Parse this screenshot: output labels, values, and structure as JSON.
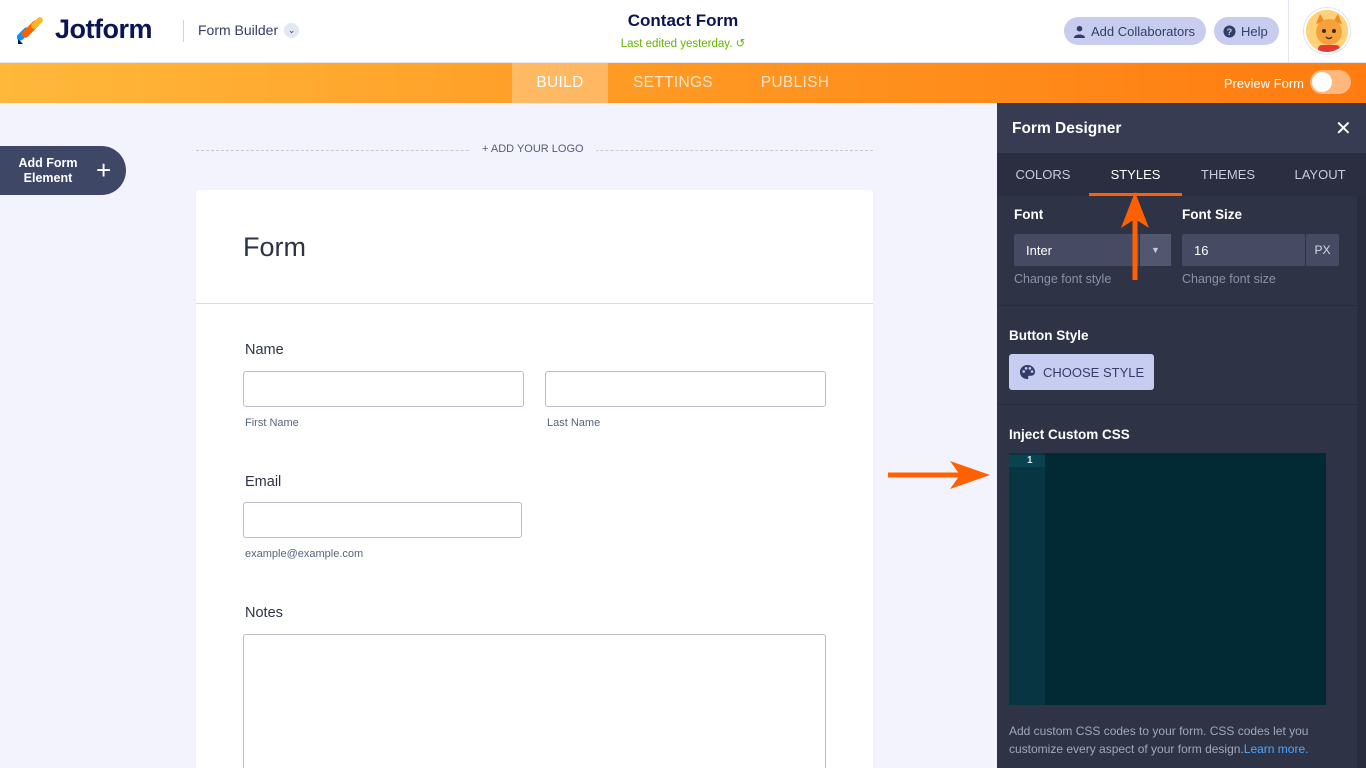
{
  "header": {
    "logo_text": "Jotform",
    "builder_label": "Form Builder",
    "form_title": "Contact Form",
    "last_edited": "Last edited yesterday.",
    "add_collaborators": "Add Collaborators",
    "help": "Help"
  },
  "nav": {
    "tabs": [
      {
        "label": "BUILD",
        "active": true
      },
      {
        "label": "SETTINGS",
        "active": false
      },
      {
        "label": "PUBLISH",
        "active": false
      }
    ],
    "preview_label": "Preview Form",
    "preview_on": false
  },
  "builder": {
    "add_element_label": "Add Form Element",
    "add_logo": "+ ADD YOUR LOGO",
    "form_heading": "Form",
    "fields": {
      "name_label": "Name",
      "first_sub": "First Name",
      "last_sub": "Last Name",
      "email_label": "Email",
      "email_sub": "example@example.com",
      "notes_label": "Notes"
    }
  },
  "designer": {
    "title": "Form Designer",
    "tabs": [
      {
        "label": "COLORS",
        "active": false
      },
      {
        "label": "STYLES",
        "active": true
      },
      {
        "label": "THEMES",
        "active": false
      },
      {
        "label": "LAYOUT",
        "active": false
      }
    ],
    "font_label": "Font",
    "font_value": "Inter",
    "font_hint": "Change font style",
    "font_size_label": "Font Size",
    "font_size_value": "16",
    "font_size_unit": "PX",
    "font_size_hint": "Change font size",
    "button_style_label": "Button Style",
    "choose_style": "CHOOSE STYLE",
    "css_label": "Inject Custom CSS",
    "css_line_number": "1",
    "help_text": "Add custom CSS codes to your form. CSS codes let you customize every aspect of your form design.",
    "learn_more": "Learn more."
  },
  "colors": {
    "accent": "#ff6100",
    "panel_bg": "#2f3346",
    "brand_navy": "#0a1551",
    "edited_green": "#64b200"
  }
}
